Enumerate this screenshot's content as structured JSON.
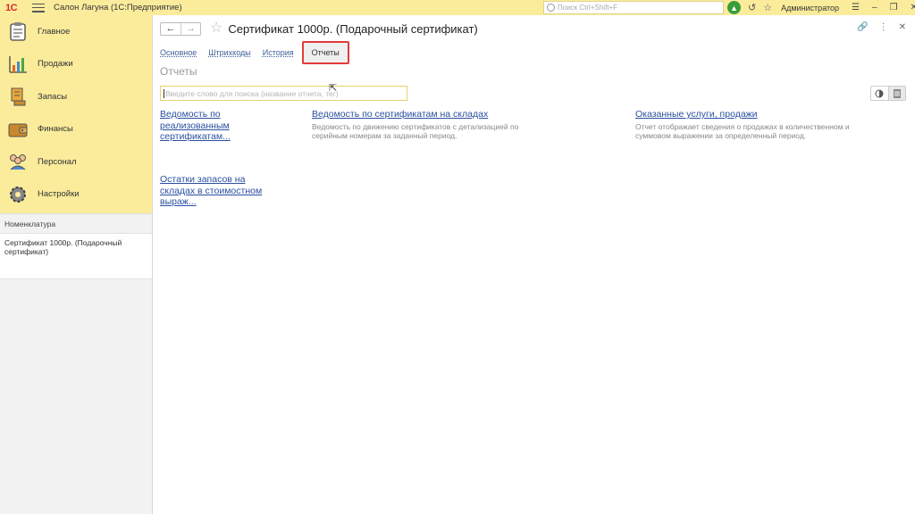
{
  "titlebar": {
    "logo": "1С",
    "app_title": "Салон Лагуна  (1С:Предприятие)",
    "search_placeholder": "Поиск Ctrl+Shift+F",
    "user": "Администратор"
  },
  "sidebar": {
    "sections": [
      {
        "label": "Главное",
        "icon": "clipboard-icon"
      },
      {
        "label": "Продажи",
        "icon": "sales-chart-icon"
      },
      {
        "label": "Запасы",
        "icon": "box-stock-icon"
      },
      {
        "label": "Финансы",
        "icon": "wallet-icon"
      },
      {
        "label": "Персонал",
        "icon": "people-icon"
      },
      {
        "label": "Настройки",
        "icon": "gear-icon"
      }
    ],
    "nav_header": "Номенклатура",
    "nav_item": "Сертификат 1000р. (Подарочный сертификат)"
  },
  "header": {
    "title": "Сертификат 1000р. (Подарочный сертификат)"
  },
  "tabs": [
    {
      "label": "Основное"
    },
    {
      "label": "Штрихкоды"
    },
    {
      "label": "История"
    },
    {
      "label": "Отчеты",
      "active": true
    }
  ],
  "section_title": "Отчеты",
  "report_search": {
    "placeholder": "Введите слово для поиска (название отчета, тег)"
  },
  "reports": [
    {
      "title": "Ведомость по реализованным сертификатам...",
      "description": ""
    },
    {
      "title": "Ведомость по сертификатам на складах",
      "description": "Ведомость по движению сертификатов с детализацией по серийным номерам за заданный период."
    },
    {
      "title": "Оказанные услуги, продажи",
      "description": "Отчет отображает сведения о продажах в количественном и суммовом выражении за определенный период."
    },
    {
      "title": "Остатки запасов на складах в стоимостном выраж...",
      "description": ""
    }
  ],
  "colors": {
    "accent_yellow": "#fbec9c",
    "link_blue": "#2a4fa0",
    "highlight_red": "#e43a3a"
  }
}
